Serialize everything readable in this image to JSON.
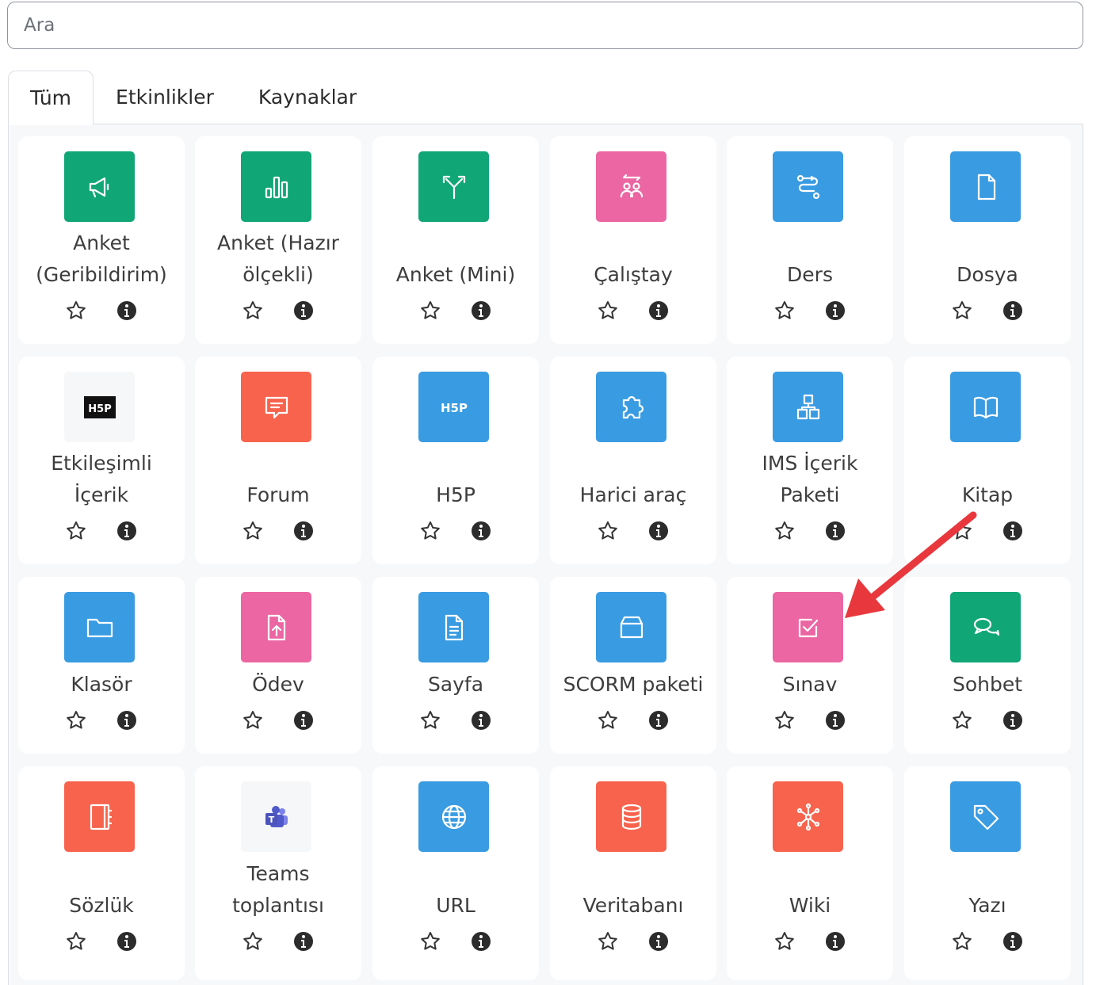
{
  "search": {
    "placeholder": "Ara"
  },
  "tabs": [
    {
      "label": "Tüm",
      "active": true
    },
    {
      "label": "Etkinlikler",
      "active": false
    },
    {
      "label": "Kaynaklar",
      "active": false
    }
  ],
  "colors": {
    "green": "#11a676",
    "pink": "#eb66a2",
    "blue": "#399be2",
    "orange": "#f7634d",
    "arrow": "#e8383d"
  },
  "modules": [
    {
      "name": "Anket (Geribildirim)",
      "lines": [
        "Anket",
        "(Geribildirim)"
      ],
      "icon": "megaphone-icon",
      "color": "green"
    },
    {
      "name": "Anket (Hazır ölçekli)",
      "lines": [
        "Anket (Hazır",
        "ölçekli)"
      ],
      "icon": "bar-chart-icon",
      "color": "green"
    },
    {
      "name": "Anket (Mini)",
      "lines": [
        "Anket (Mini)"
      ],
      "icon": "signpost-icon",
      "color": "green"
    },
    {
      "name": "Çalıştay",
      "lines": [
        "Çalıştay"
      ],
      "icon": "people-exchange-icon",
      "color": "pink"
    },
    {
      "name": "Ders",
      "lines": [
        "Ders"
      ],
      "icon": "path-icon",
      "color": "blue"
    },
    {
      "name": "Dosya",
      "lines": [
        "Dosya"
      ],
      "icon": "file-icon",
      "color": "blue"
    },
    {
      "name": "Etkileşimli İçerik",
      "lines": [
        "Etkileşimli",
        "İçerik"
      ],
      "icon": "h5p-logo-icon",
      "color": "plain"
    },
    {
      "name": "Forum",
      "lines": [
        "Forum"
      ],
      "icon": "chat-bubble-icon",
      "color": "orange"
    },
    {
      "name": "H5P",
      "lines": [
        "H5P"
      ],
      "icon": "h5p-icon",
      "color": "blue"
    },
    {
      "name": "Harici araç",
      "lines": [
        "Harici araç"
      ],
      "icon": "puzzle-icon",
      "color": "blue"
    },
    {
      "name": "IMS İçerik Paketi",
      "lines": [
        "IMS İçerik",
        "Paketi"
      ],
      "icon": "boxes-icon",
      "color": "blue"
    },
    {
      "name": "Kitap",
      "lines": [
        "Kitap"
      ],
      "icon": "book-icon",
      "color": "blue"
    },
    {
      "name": "Klasör",
      "lines": [
        "Klasör"
      ],
      "icon": "folder-icon",
      "color": "blue"
    },
    {
      "name": "Ödev",
      "lines": [
        "Ödev"
      ],
      "icon": "file-upload-icon",
      "color": "pink"
    },
    {
      "name": "Sayfa",
      "lines": [
        "Sayfa"
      ],
      "icon": "document-icon",
      "color": "blue"
    },
    {
      "name": "SCORM paketi",
      "lines": [
        "SCORM paketi"
      ],
      "icon": "package-icon",
      "color": "blue"
    },
    {
      "name": "Sınav",
      "lines": [
        "Sınav"
      ],
      "icon": "checkbox-icon",
      "color": "pink"
    },
    {
      "name": "Sohbet",
      "lines": [
        "Sohbet"
      ],
      "icon": "chat-bubbles-icon",
      "color": "green"
    },
    {
      "name": "Sözlük",
      "lines": [
        "Sözlük"
      ],
      "icon": "notebook-icon",
      "color": "orange"
    },
    {
      "name": "Teams toplantısı",
      "lines": [
        "Teams",
        "toplantısı"
      ],
      "icon": "teams-logo-icon",
      "color": "plain"
    },
    {
      "name": "URL",
      "lines": [
        "URL"
      ],
      "icon": "globe-icon",
      "color": "blue"
    },
    {
      "name": "Veritabanı",
      "lines": [
        "Veritabanı"
      ],
      "icon": "database-icon",
      "color": "orange"
    },
    {
      "name": "Wiki",
      "lines": [
        "Wiki"
      ],
      "icon": "network-icon",
      "color": "orange"
    },
    {
      "name": "Yazı",
      "lines": [
        "Yazı"
      ],
      "icon": "tag-icon",
      "color": "blue"
    }
  ],
  "action_icons": {
    "favourite": "star-outline-icon",
    "info": "info-circle-icon"
  },
  "annotation": {
    "type": "arrow",
    "points_to": "Sınav"
  }
}
